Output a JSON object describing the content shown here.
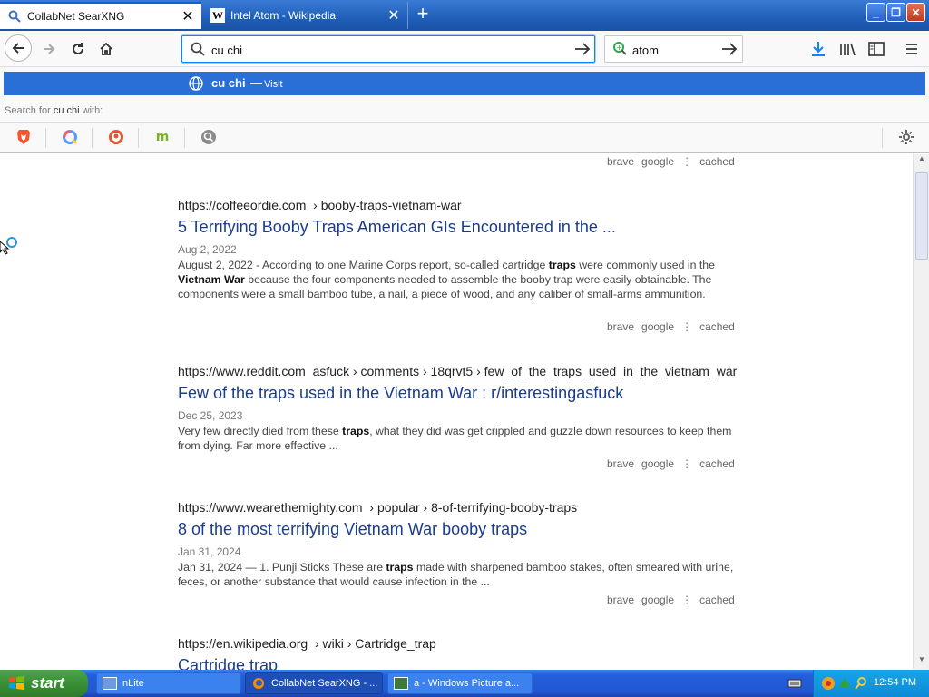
{
  "browser": {
    "tabs": [
      {
        "title": "CollabNet SearXNG",
        "active": true
      },
      {
        "title": "Intel Atom - Wikipedia",
        "active": false
      }
    ],
    "url_value": "cu chi",
    "search_value": "atom"
  },
  "suggestion": {
    "text": "cu chi",
    "separator": "—",
    "action": "Visit",
    "search_for_prefix": "Search for",
    "search_for_term": "cu chi",
    "search_for_suffix": "with:"
  },
  "engines": [
    "brave-icon",
    "qwant-icon",
    "duckduckgo-icon",
    "mojeek-icon",
    "searx-icon"
  ],
  "result_actions": {
    "brave": "brave",
    "google": "google",
    "more": "⋮",
    "cached": "cached"
  },
  "results": [
    {
      "url_host": "https://coffeeordie.com",
      "url_path": "› booby-traps-vietnam-war",
      "title": "5 Terrifying Booby Traps American GIs Encountered in the ...",
      "date": "Aug 2, 2022",
      "snippet": [
        {
          "t": "August 2, 2022 - According to one Marine Corps report, so-called cartridge "
        },
        {
          "t": "traps",
          "b": true
        },
        {
          "t": " were commonly used in the "
        },
        {
          "t": "Vietnam War",
          "b": true
        },
        {
          "t": " because the four components needed to assemble the booby trap were easily obtainable. The components were a small bamboo tube, a nail, a piece of wood, and any caliber of small-arms ammunition."
        }
      ]
    },
    {
      "url_host": "https://www.reddit.com",
      "url_path": "asfuck › comments › 18qrvt5 › few_of_the_traps_used_in_the_vietnam_war",
      "title": "Few of the traps used in the Vietnam War : r/interestingasfuck",
      "date": "Dec 25, 2023",
      "snippet": [
        {
          "t": "Very few directly died from these "
        },
        {
          "t": "traps",
          "b": true
        },
        {
          "t": ", what they did was get crippled and guzzle down resources to keep them from dying. Far more effective ..."
        }
      ]
    },
    {
      "url_host": "https://www.wearethemighty.com",
      "url_path": "› popular › 8-of-terrifying-booby-traps",
      "title": "8 of the most terrifying Vietnam War booby traps",
      "date": "Jan 31, 2024",
      "snippet": [
        {
          "t": "Jan 31, 2024 — 1. Punji Sticks These are "
        },
        {
          "t": "traps",
          "b": true
        },
        {
          "t": " made with sharpened bamboo stakes, often smeared with urine, feces, or another substance that would cause infection in the ..."
        }
      ]
    },
    {
      "url_host": "https://en.wikipedia.org",
      "url_path": "› wiki › Cartridge_trap",
      "title": "Cartridge trap"
    }
  ],
  "taskbar": {
    "start": "start",
    "tasks": [
      {
        "label": "nLite",
        "active": false
      },
      {
        "label": "CollabNet SearXNG - ...",
        "active": true
      },
      {
        "label": "a - Windows Picture a...",
        "active": false
      }
    ],
    "clock": "12:54 PM"
  },
  "colors": {
    "accent": "#2a6fd5",
    "link": "#1a3c8f",
    "taskbar": "#245edb"
  }
}
